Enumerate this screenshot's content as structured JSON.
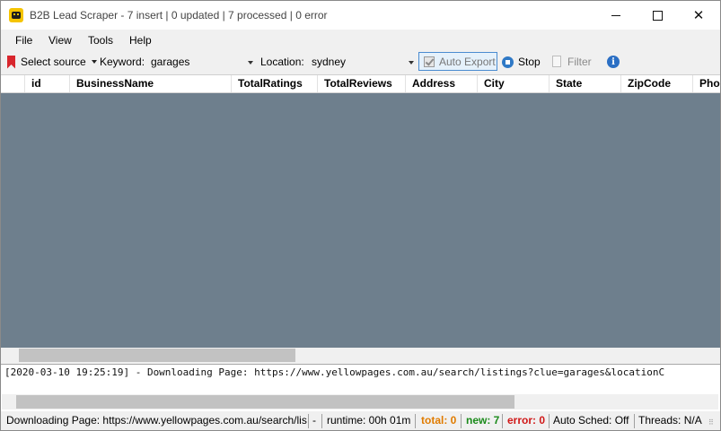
{
  "window": {
    "title": "B2B Lead Scraper - 7 insert | 0 updated | 7 processed | 0 error",
    "controls": {
      "minimize": "",
      "maximize": "",
      "close": "✕"
    }
  },
  "menu": {
    "items": [
      "File",
      "View",
      "Tools",
      "Help"
    ]
  },
  "toolbar": {
    "select_source_label": "Select source",
    "keyword_label": "Keyword:",
    "keyword_value": "garages",
    "location_label": "Location:",
    "location_value": "sydney",
    "auto_export_label": "Auto Export",
    "stop_label": "Stop",
    "filter_label": "Filter",
    "info_icon_glyph": "i"
  },
  "grid": {
    "columns": [
      "id",
      "BusinessName",
      "TotalRatings",
      "TotalReviews",
      "Address",
      "City",
      "State",
      "ZipCode",
      "Pho"
    ],
    "rows": [],
    "background_color": "#6e7f8d"
  },
  "log": {
    "line": "[2020-03-10 19:25:19] - Downloading Page: https://www.yellowpages.com.au/search/listings?clue=garages&locationC"
  },
  "status": {
    "downloading": "Downloading Page: https://www.yellowpages.com.au/search/lis",
    "dash": "-",
    "runtime": "runtime: 00h 01m",
    "total": "total: 0",
    "new": "new: 7",
    "error": "error: 0",
    "auto_sched": "Auto Sched: Off",
    "threads": "Threads: N/A"
  },
  "colors": {
    "total": "#e07b00",
    "new": "#1a8a1a",
    "error": "#d01818",
    "accent": "#2f79c6"
  }
}
